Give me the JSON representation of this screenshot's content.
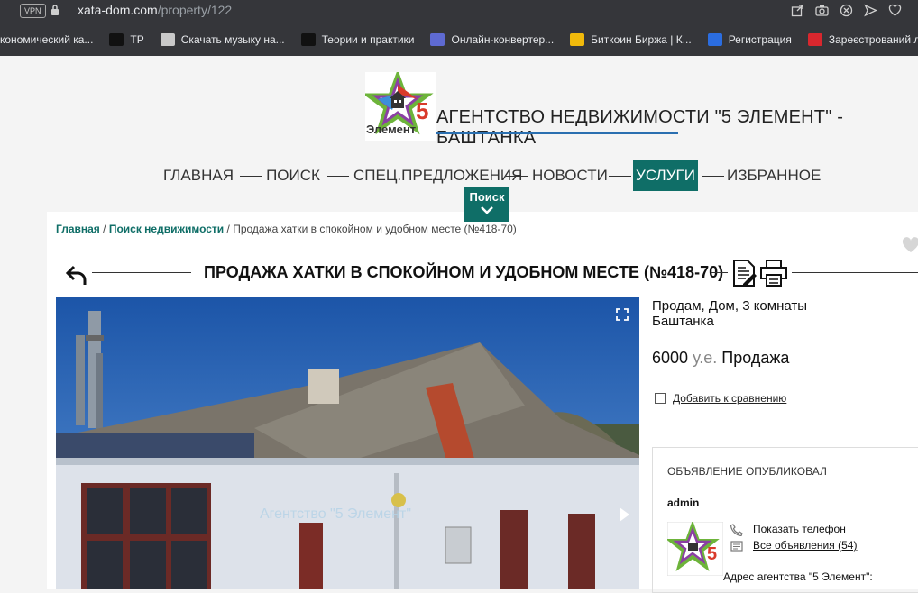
{
  "browser": {
    "vpn_label": "VPN",
    "url_host": "xata-dom.com",
    "url_path": "/property/122",
    "bookmarks": [
      {
        "label": "кономический ка...",
        "color": "#3a3a3a"
      },
      {
        "label": "TP",
        "color": "#111111"
      },
      {
        "label": "Скачать музыку на...",
        "color": "#c9c9c9"
      },
      {
        "label": "Теории и практики",
        "color": "#111111"
      },
      {
        "label": "Онлайн-конвертер...",
        "color": "#5e6ad2"
      },
      {
        "label": "Биткоин Биржа | К...",
        "color": "#f0b90b"
      },
      {
        "label": "Регистрация",
        "color": "#2b6de0"
      },
      {
        "label": "Зареєстрований л...",
        "color": "#d9272e"
      }
    ]
  },
  "site": {
    "title": "АГЕНТСТВО НЕДВИЖИМОСТИ \"5 ЭЛЕМЕНТ\" - БАШТАНКА",
    "accent": "#0f6e67"
  },
  "nav": {
    "items": [
      "ГЛАВНАЯ",
      "ПОИСК",
      "СПЕЦ.ПРЕДЛОЖЕНИЯ",
      "НОВОСТИ",
      "УСЛУГИ",
      "ИЗБРАННОЕ"
    ],
    "active": "УСЛУГИ",
    "search_tab": "Поиск"
  },
  "breadcrumb": {
    "home": "Главная",
    "search": "Поиск недвижимости",
    "sep": " / ",
    "current": "Продажа хатки в спокойном и удобном месте (№418-70)"
  },
  "property": {
    "title": "ПРОДАЖА ХАТКИ В СПОКОЙНОМ И УДОБНОМ МЕСТЕ (№418-70)",
    "summary": "Продам, Дом, 3 комнаты",
    "city": "Баштанка",
    "price": "6000",
    "currency": "у.е.",
    "deal": "Продажа",
    "compare_label": "Добавить к сравнению",
    "watermark": "Агентство \"5 Элемент\""
  },
  "publisher": {
    "heading": "ОБЪЯВЛЕНИЕ ОПУБЛИКОВАЛ",
    "user": "admin",
    "show_phone": "Показать телефон",
    "all_ads": "Все объявления (54)",
    "address": "Адрес агентства \"5 Элемент\":"
  },
  "logo": {
    "text": "Элемент",
    "number": "5"
  },
  "icons": {
    "lock": "lock-icon",
    "share": "share-icon",
    "camera": "camera-icon",
    "block": "block-icon",
    "send": "send-icon",
    "heart": "heart-icon",
    "back": "back-arrow-icon",
    "doc": "document-icon",
    "print": "print-icon",
    "expand": "expand-icon",
    "next": "next-arrow-icon",
    "phone": "phone-icon",
    "list": "list-icon"
  }
}
